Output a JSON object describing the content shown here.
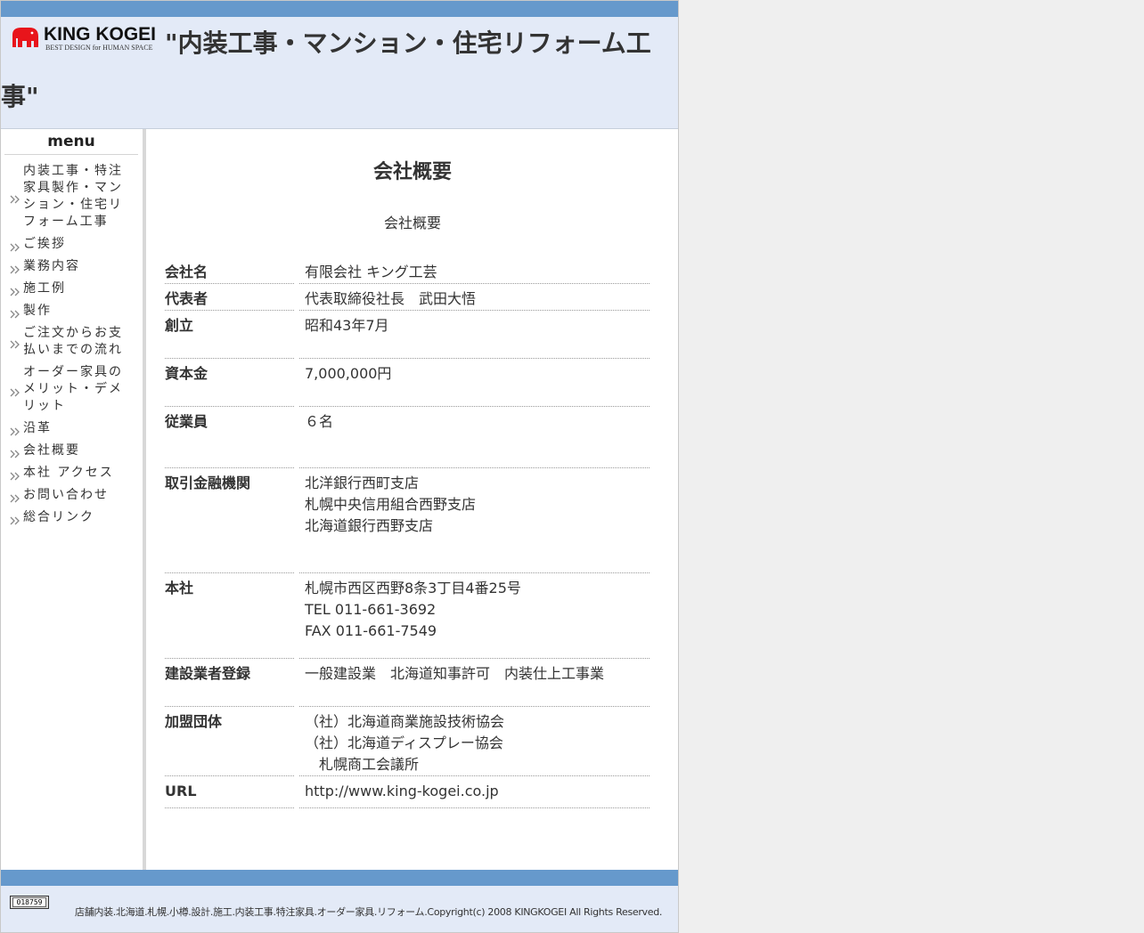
{
  "header": {
    "logo_text": "KING KOGEI",
    "logo_tagline": "BEST DESIGN for HUMAN SPACE",
    "title": "\"内装工事・マンション・住宅リフォーム工事\""
  },
  "sidebar": {
    "title": "menu",
    "items": [
      {
        "label": "内装工事・特注家具製作・マンション・住宅リフォーム工事"
      },
      {
        "label": "ご挨拶"
      },
      {
        "label": "業務内容"
      },
      {
        "label": "施工例"
      },
      {
        "label": "製作"
      },
      {
        "label": "ご注文からお支払いまでの流れ"
      },
      {
        "label": "オーダー家具のメリット・デメリット"
      },
      {
        "label": "沿革"
      },
      {
        "label": "会社概要"
      },
      {
        "label": "本社 アクセス"
      },
      {
        "label": "お問い合わせ"
      },
      {
        "label": "総合リンク"
      }
    ]
  },
  "main": {
    "title": "会社概要",
    "subtitle": "会社概要",
    "rows": [
      {
        "key": "会社名",
        "lines": [
          "有限会社 キング工芸"
        ]
      },
      {
        "key": "代表者",
        "lines": [
          "代表取締役社長　武田大悟"
        ]
      },
      {
        "key": "創立",
        "lines": [
          "昭和43年7月"
        ]
      },
      {
        "key": "資本金",
        "lines": [
          "7,000,000円"
        ]
      },
      {
        "key": "従業員",
        "lines": [
          "６名"
        ]
      },
      {
        "key": "取引金融機関",
        "lines": [
          "北洋銀行西町支店",
          "札幌中央信用組合西野支店",
          "北海道銀行西野支店"
        ]
      },
      {
        "key": "本社",
        "lines": [
          "札幌市西区西野8条3丁目4番25号",
          "TEL  011-661-3692",
          "FAX  011-661-7549"
        ]
      },
      {
        "key": "建設業者登録",
        "lines": [
          "一般建設業　北海道知事許可　内装仕上工事業"
        ]
      },
      {
        "key": "加盟団体",
        "lines": [
          "（社）北海道商業施設技術協会",
          "（社）北海道ディスプレー協会",
          "　札幌商工会議所"
        ]
      },
      {
        "key": "URL",
        "lines": [
          "http://www.king-kogei.co.jp"
        ]
      }
    ]
  },
  "footer": {
    "counter": "018759",
    "copyright": "店舗内装.北海道.札幌.小樽.設計.施工.内装工事.特注家具.オーダー家具.リフォーム.Copyright(c) 2008 KINGKOGEI All Rights Reserved."
  }
}
